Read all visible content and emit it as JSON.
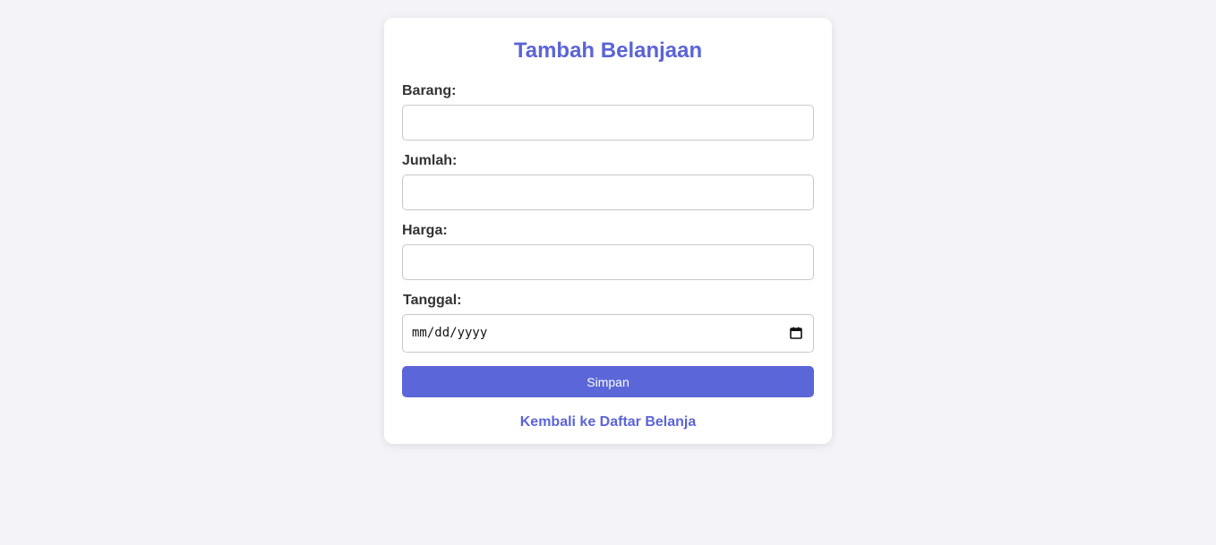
{
  "form": {
    "title": "Tambah Belanjaan",
    "fields": {
      "barang": {
        "label": "Barang:",
        "value": "",
        "placeholder": ""
      },
      "jumlah": {
        "label": "Jumlah:",
        "value": "",
        "placeholder": ""
      },
      "harga": {
        "label": "Harga:",
        "value": "",
        "placeholder": ""
      },
      "tanggal": {
        "label": "Tanggal:",
        "placeholder": "mm/dd/yyyy",
        "icon": "calendar-icon"
      }
    },
    "submit_label": "Simpan",
    "back_link_label": "Kembali ke Daftar Belanja"
  },
  "colors": {
    "accent": "#5b64d6",
    "button": "#5b67d8",
    "page_background": "#f4f4f8",
    "card_background": "#ffffff",
    "label_text": "#333333"
  }
}
